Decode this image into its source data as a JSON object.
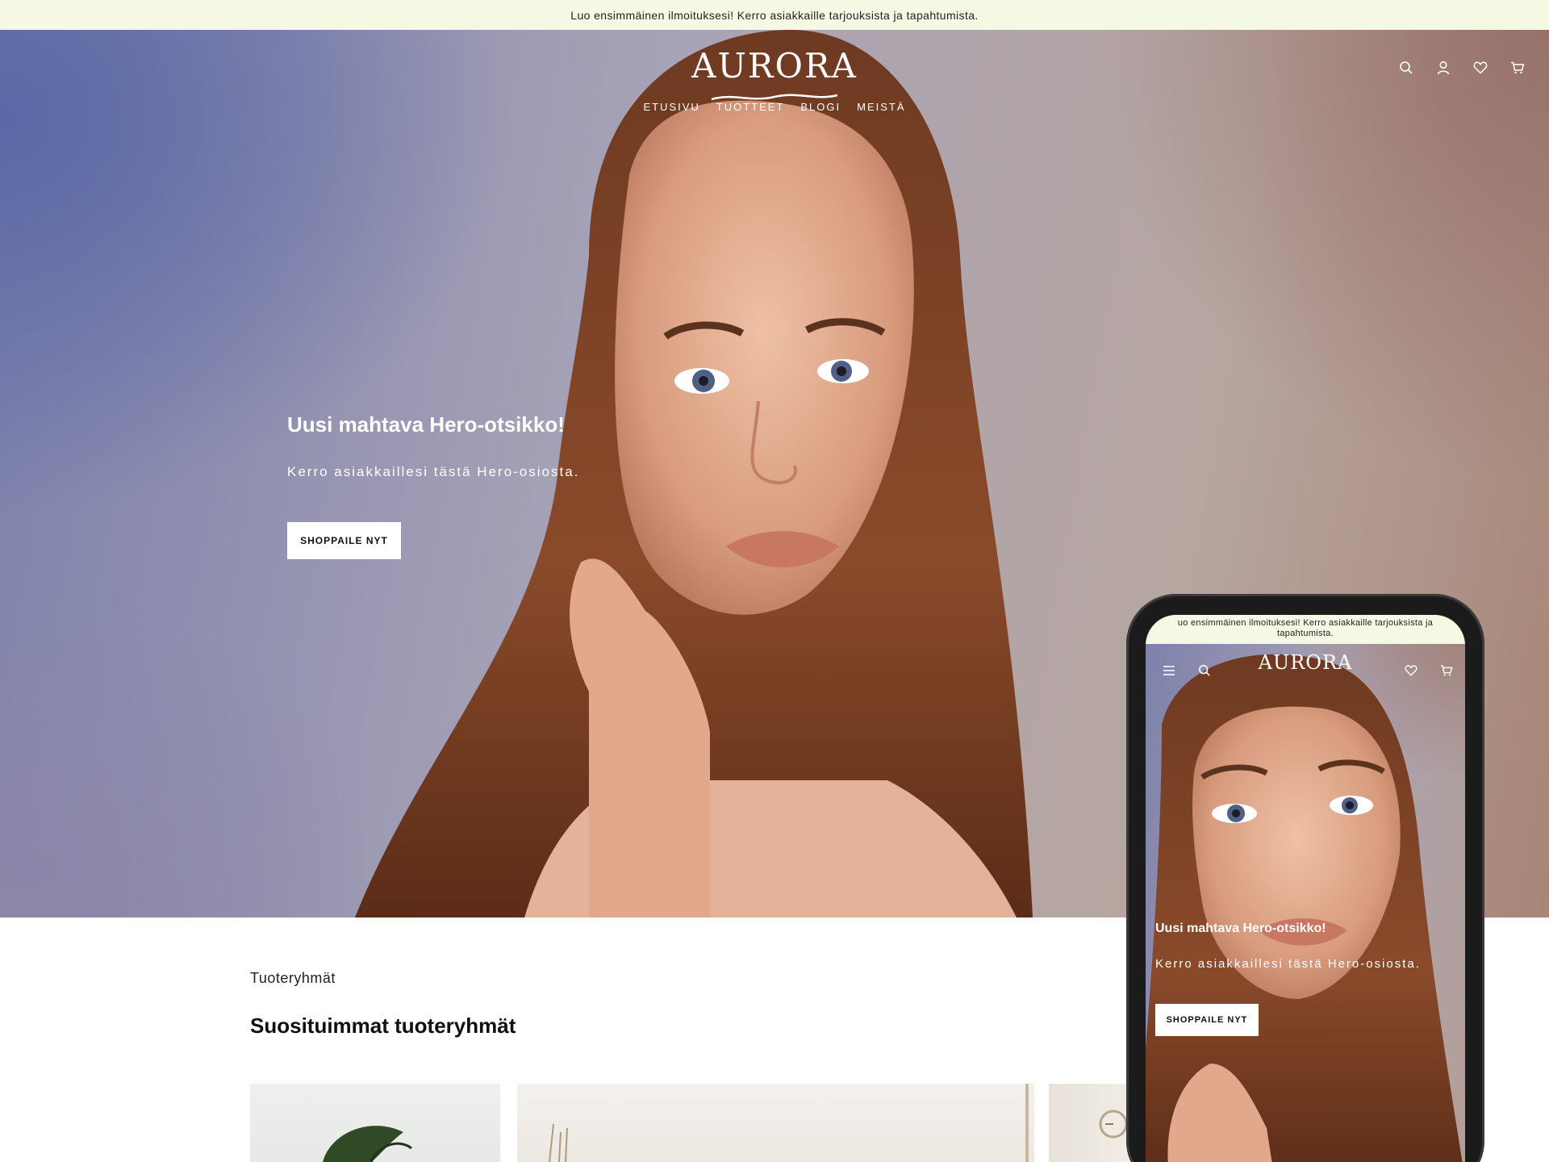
{
  "announcement": "Luo ensimmäinen ilmoituksesi! Kerro asiakkaille tarjouksista ja tapahtumista.",
  "brand": "AURORA",
  "nav": [
    "ETUSIVU",
    "TUOTTEET",
    "BLOGI",
    "MEISTÄ"
  ],
  "header_icons": [
    "search-icon",
    "account-icon",
    "heart-icon",
    "cart-icon"
  ],
  "hero": {
    "title": "Uusi mahtava Hero-otsikko!",
    "subtitle": "Kerro asiakkaillesi tästä Hero-osiosta.",
    "button": "SHOPPAILE NYT"
  },
  "section": {
    "kicker": "Tuoteryhmät",
    "title": "Suosituimmat tuoteryhmät"
  },
  "mobile": {
    "announcement": "uo ensimmäinen ilmoituksesi! Kerro asiakkaille tarjouksista ja\ntapahtumista.",
    "brand": "AURORA",
    "icons": [
      "menu-icon",
      "search-icon",
      "heart-icon",
      "cart-icon"
    ],
    "hero_title": "Uusi mahtava Hero-otsikko!",
    "hero_subtitle": "Kerro asiakkaillesi tästä Hero-osiosta.",
    "button": "SHOPPAILE NYT"
  }
}
